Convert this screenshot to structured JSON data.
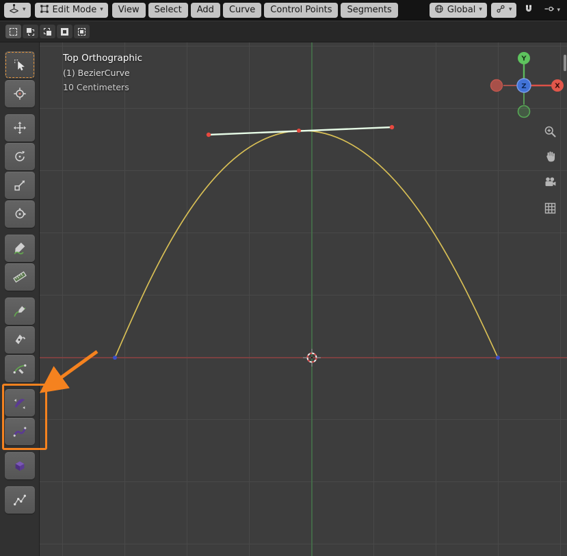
{
  "header": {
    "mode_label": "Edit Mode",
    "menus": [
      "View",
      "Select",
      "Add",
      "Curve",
      "Control Points",
      "Segments"
    ],
    "orientation_label": "Global"
  },
  "tool_settings": {
    "select_modes": [
      "Set",
      "Extend",
      "Subtract",
      "Invert",
      "Intersect"
    ]
  },
  "toolbar": {
    "tools": [
      {
        "id": "select-box",
        "active": true
      },
      {
        "id": "cursor"
      },
      {
        "id": "move",
        "group_start": true
      },
      {
        "id": "rotate"
      },
      {
        "id": "scale"
      },
      {
        "id": "transform"
      },
      {
        "id": "annotate",
        "group_start": true
      },
      {
        "id": "measure"
      },
      {
        "id": "draw",
        "group_start": true
      },
      {
        "id": "pen"
      },
      {
        "id": "curve-pen"
      },
      {
        "id": "tilt",
        "group_start": true,
        "highlighted": true
      },
      {
        "id": "radius",
        "highlighted": true
      },
      {
        "id": "extrude",
        "group_start": true
      },
      {
        "id": "randomize",
        "group_start": true
      }
    ]
  },
  "viewport": {
    "view_label": "Top Orthographic",
    "object_label": "(1) BezierCurve",
    "scale_label": "10 Centimeters",
    "gizmo": {
      "x": "X",
      "y": "Y",
      "z": "Z"
    }
  },
  "annotation": {
    "highlight_color": "#f5821f",
    "target_tools": [
      "tilt",
      "radius"
    ]
  },
  "icons": {
    "header": [
      "editor-type-icon",
      "edit-mode-icon",
      "orientation-globe-icon",
      "pivot-point-icon",
      "snap-magnet-icon",
      "snap-target-icon",
      "chevron-down-icon"
    ],
    "nav": [
      "zoom-icon",
      "pan-hand-icon",
      "camera-view-icon",
      "grid-overlay-icon"
    ]
  },
  "colors": {
    "accent_orange": "#f5821f",
    "curve_yellow": "#d8bf55",
    "axis_x_red": "#8e4040",
    "axis_y_green": "#44794a",
    "handle_selected": "#e6fbe6",
    "control_point_red": "#e8493f",
    "anchor_blue": "#3c4ec8",
    "gizmo_x": "#e2574b",
    "gizmo_y": "#5ec45e",
    "gizmo_z": "#4273d8"
  }
}
